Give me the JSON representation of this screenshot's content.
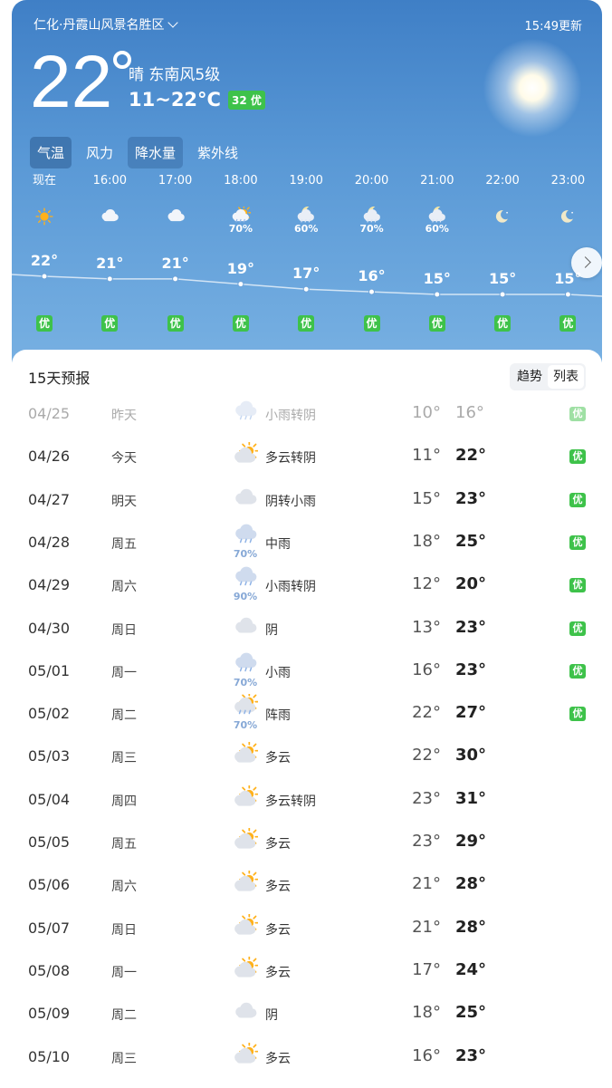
{
  "header": {
    "location": "仁化·丹霞山风景名胜区",
    "update_time": "15:49更新",
    "current_temp": "22",
    "condition": "晴 东南风5级",
    "range": "11~22°C",
    "aqi": "32 优"
  },
  "tabs": [
    {
      "label": "气温"
    },
    {
      "label": "风力"
    },
    {
      "label": "降水量"
    },
    {
      "label": "紫外线"
    }
  ],
  "hourly": [
    {
      "time": "现在",
      "icon": "sun-icon",
      "pop": "",
      "temp": "22°",
      "aqi": "优",
      "t": 22
    },
    {
      "time": "16:00",
      "icon": "cloud-icon",
      "pop": "",
      "temp": "21°",
      "aqi": "优",
      "t": 21
    },
    {
      "time": "17:00",
      "icon": "cloud-icon",
      "pop": "",
      "temp": "21°",
      "aqi": "优",
      "t": 21
    },
    {
      "time": "18:00",
      "icon": "sun-cloud-rain-icon",
      "pop": "70%",
      "temp": "19°",
      "aqi": "优",
      "t": 19
    },
    {
      "time": "19:00",
      "icon": "moon-cloud-rain-icon",
      "pop": "60%",
      "temp": "17°",
      "aqi": "优",
      "t": 17
    },
    {
      "time": "20:00",
      "icon": "moon-cloud-rain-icon",
      "pop": "70%",
      "temp": "16°",
      "aqi": "优",
      "t": 16
    },
    {
      "time": "21:00",
      "icon": "moon-cloud-rain-icon",
      "pop": "60%",
      "temp": "15°",
      "aqi": "优",
      "t": 15
    },
    {
      "time": "22:00",
      "icon": "moon-icon",
      "pop": "",
      "temp": "15°",
      "aqi": "优",
      "t": 15
    },
    {
      "time": "23:00",
      "icon": "moon-icon",
      "pop": "",
      "temp": "15°",
      "aqi": "优",
      "t": 15
    }
  ],
  "forecast": {
    "title": "15天预报",
    "toggle": [
      "趋势",
      "列表"
    ],
    "days": [
      {
        "date": "04/25",
        "week": "昨天",
        "icon": "cloud-rain-icon",
        "pop": "",
        "desc": "小雨转阴",
        "lo": "10°",
        "hi": "16°",
        "aqi": "优",
        "past": true
      },
      {
        "date": "04/26",
        "week": "今天",
        "icon": "sun-cloud-icon",
        "pop": "",
        "desc": "多云转阴",
        "lo": "11°",
        "hi": "22°",
        "aqi": "优"
      },
      {
        "date": "04/27",
        "week": "明天",
        "icon": "cloud-icon",
        "pop": "",
        "desc": "阴转小雨",
        "lo": "15°",
        "hi": "23°",
        "aqi": "优"
      },
      {
        "date": "04/28",
        "week": "周五",
        "icon": "cloud-rain-icon",
        "pop": "70%",
        "desc": "中雨",
        "lo": "18°",
        "hi": "25°",
        "aqi": "优"
      },
      {
        "date": "04/29",
        "week": "周六",
        "icon": "cloud-rain-icon",
        "pop": "90%",
        "desc": "小雨转阴",
        "lo": "12°",
        "hi": "20°",
        "aqi": "优"
      },
      {
        "date": "04/30",
        "week": "周日",
        "icon": "cloud-icon",
        "pop": "",
        "desc": "阴",
        "lo": "13°",
        "hi": "23°",
        "aqi": "优"
      },
      {
        "date": "05/01",
        "week": "周一",
        "icon": "cloud-rain-icon",
        "pop": "70%",
        "desc": "小雨",
        "lo": "16°",
        "hi": "23°",
        "aqi": "优"
      },
      {
        "date": "05/02",
        "week": "周二",
        "icon": "sun-cloud-rain-icon",
        "pop": "70%",
        "desc": "阵雨",
        "lo": "22°",
        "hi": "27°",
        "aqi": "优"
      },
      {
        "date": "05/03",
        "week": "周三",
        "icon": "sun-cloud-icon",
        "pop": "",
        "desc": "多云",
        "lo": "22°",
        "hi": "30°",
        "aqi": ""
      },
      {
        "date": "05/04",
        "week": "周四",
        "icon": "sun-cloud-icon",
        "pop": "",
        "desc": "多云转阴",
        "lo": "23°",
        "hi": "31°",
        "aqi": ""
      },
      {
        "date": "05/05",
        "week": "周五",
        "icon": "sun-cloud-icon",
        "pop": "",
        "desc": "多云",
        "lo": "23°",
        "hi": "29°",
        "aqi": ""
      },
      {
        "date": "05/06",
        "week": "周六",
        "icon": "sun-cloud-icon",
        "pop": "",
        "desc": "多云",
        "lo": "21°",
        "hi": "28°",
        "aqi": ""
      },
      {
        "date": "05/07",
        "week": "周日",
        "icon": "sun-cloud-icon",
        "pop": "",
        "desc": "多云",
        "lo": "21°",
        "hi": "28°",
        "aqi": ""
      },
      {
        "date": "05/08",
        "week": "周一",
        "icon": "sun-cloud-icon",
        "pop": "",
        "desc": "多云",
        "lo": "17°",
        "hi": "24°",
        "aqi": ""
      },
      {
        "date": "05/09",
        "week": "周二",
        "icon": "cloud-icon",
        "pop": "",
        "desc": "阴",
        "lo": "18°",
        "hi": "25°",
        "aqi": ""
      },
      {
        "date": "05/10",
        "week": "周三",
        "icon": "sun-cloud-icon",
        "pop": "",
        "desc": "多云",
        "lo": "16°",
        "hi": "23°",
        "aqi": ""
      }
    ]
  },
  "colors": {
    "aqi_good": "#3ec24a",
    "sky_top": "#3f7fc6",
    "sky_bottom": "#77b0e2"
  }
}
